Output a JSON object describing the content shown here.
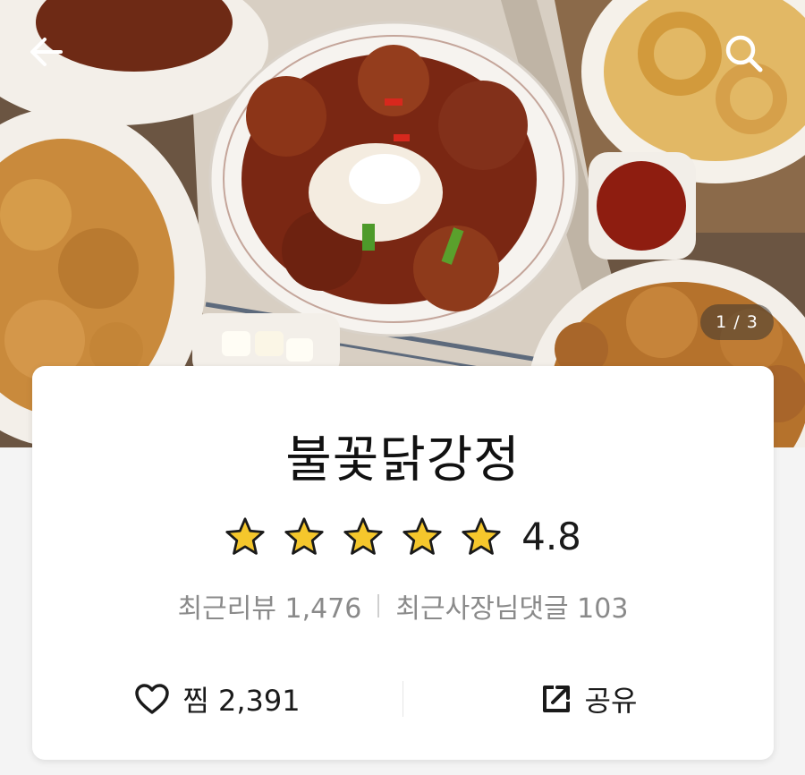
{
  "header": {
    "back_icon": "arrow-left-icon",
    "search_icon": "search-icon",
    "image_counter": "1 / 3"
  },
  "store": {
    "name": "불꽃닭강정",
    "rating": "4.8",
    "rating_stars": 5,
    "star_color": "#f5c72c",
    "recent_reviews": "최근리뷰 1,476",
    "owner_replies": "최근사장님댓글 103"
  },
  "actions": {
    "like_icon": "heart-outline-icon",
    "like_label": "찜 2,391",
    "share_icon": "share-icon",
    "share_label": "공유"
  }
}
